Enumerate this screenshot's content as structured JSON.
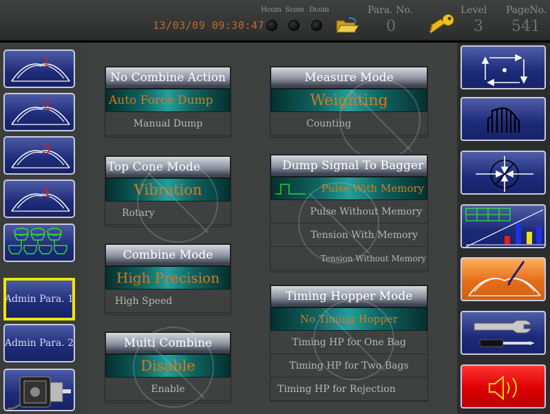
{
  "header": {
    "datetime": "13/03/09 09:30:47",
    "com_labels": [
      "Hcom",
      "Scom",
      "Dcom"
    ],
    "para_no_label": "Para. No.",
    "para_no_value": "0",
    "level_label": "Level",
    "level_value": "3",
    "page_no_label": "PageNo.",
    "page_no_value": "541"
  },
  "left_nav": {
    "book_numbers": [
      "1",
      "2",
      "3",
      "4"
    ],
    "admin_para_1": "Admin Para. 1",
    "admin_para_2": "Admin Para. 2"
  },
  "groups": {
    "no_combine_action": {
      "title": "No Combine Action",
      "options": [
        "Auto Force Dump",
        "Manual Dump"
      ],
      "selected": "Auto Force Dump"
    },
    "top_cone_mode": {
      "title": "Top Cone Mode",
      "options": [
        "Vibration",
        "Rotary"
      ],
      "selected": "Vibration"
    },
    "combine_mode": {
      "title": "Combine Mode",
      "options": [
        "High Precision",
        "High Speed"
      ],
      "selected": "High Precision"
    },
    "multi_combine": {
      "title": "Multi Combine",
      "options": [
        "Disable",
        "Enable"
      ],
      "selected": "Disable"
    },
    "measure_mode": {
      "title": "Measure Mode",
      "options": [
        "Weighting",
        "Counting"
      ],
      "selected": "Weighting"
    },
    "dump_signal": {
      "title": "Dump Signal To Bagger",
      "options": [
        "Pulse With Memory",
        "Pulse Without Memory",
        "Tension With Memory",
        "Tension Without Memory"
      ],
      "selected": "Pulse With Memory"
    },
    "timing_hopper": {
      "title": "Timing Hopper Mode",
      "options": [
        "No Timing Hopper",
        "Timing HP for One Bag",
        "Timing HP for Two Bags",
        "Timing HP for Rejection"
      ],
      "selected": "No Timing Hopper"
    }
  },
  "colors": {
    "selected_text": "#d9781c",
    "selected_bg": "#1a8c88",
    "nav_blue": "#1e2b78",
    "highlight_border": "#f2e600",
    "orange_button": "#e56d18",
    "red_button": "#dd0000"
  }
}
